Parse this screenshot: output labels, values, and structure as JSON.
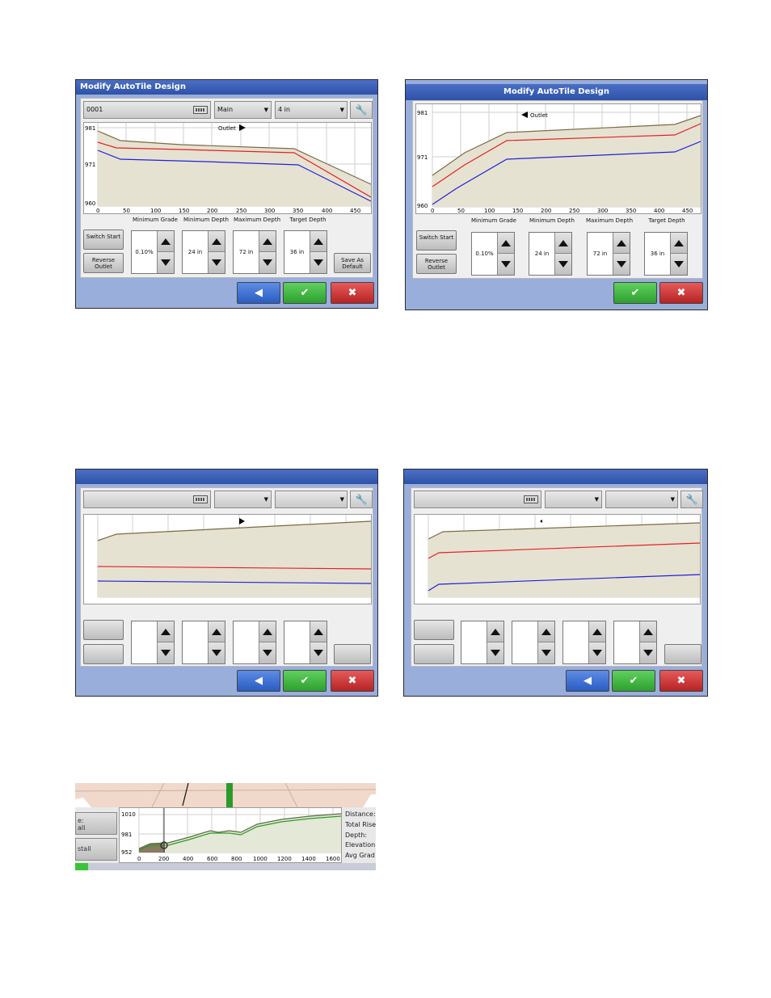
{
  "panel1": {
    "title": "Modify AutoTile Design",
    "name_value": "0001",
    "line_value": "Main",
    "tile_value": "4 in",
    "outlet_label": "Outlet",
    "y_ticks": [
      "981",
      "971",
      "960"
    ],
    "x_ticks": [
      "0",
      "50",
      "100",
      "150",
      "200",
      "250",
      "300",
      "350",
      "400",
      "450"
    ],
    "buttons": {
      "switch_start": "Switch Start",
      "reverse_outlet": "Reverse Outlet",
      "save_default": "Save As Default"
    },
    "params": [
      {
        "label": "Minimum Grade",
        "value": "0.10%"
      },
      {
        "label": "Minimum Depth",
        "value": "24 in"
      },
      {
        "label": "Maximum Depth",
        "value": "72 in"
      },
      {
        "label": "Target Depth",
        "value": "36 in"
      }
    ]
  },
  "panel2": {
    "title": "Modify AutoTile Design",
    "outlet_label": "Outlet",
    "y_ticks": [
      "981",
      "971",
      "960"
    ],
    "x_ticks": [
      "0",
      "50",
      "100",
      "150",
      "200",
      "250",
      "300",
      "350",
      "400",
      "450"
    ],
    "buttons": {
      "switch_start": "Switch Start",
      "reverse_outlet": "Reverse Outlet"
    },
    "params": [
      {
        "label": "Minimum Grade",
        "value": "0.10%"
      },
      {
        "label": "Minimum Depth",
        "value": "24 in"
      },
      {
        "label": "Maximum Depth",
        "value": "72 in"
      },
      {
        "label": "Target Depth",
        "value": "36 in"
      }
    ]
  },
  "panel5": {
    "y_ticks": [
      "1010",
      "981",
      "952"
    ],
    "x_ticks": [
      "0",
      "200",
      "400",
      "600",
      "800",
      "1000",
      "1200",
      "1400",
      "1600"
    ],
    "btn_top": "e:\nall",
    "btn_bottom": "stall",
    "stats": [
      "Distance:",
      "Total Rise",
      "Depth:",
      "Elevation",
      "Avg Grad"
    ]
  },
  "colors": {
    "surface": "#7b6a45",
    "fill": "#e6e2d2",
    "target_line": "#e52020",
    "tile_line": "#2020d8"
  },
  "icons": {
    "back": "left-arrow-icon",
    "ok": "check-icon",
    "cancel": "x-icon",
    "settings": "wrench-icon",
    "keyboard": "keyboard-icon"
  }
}
